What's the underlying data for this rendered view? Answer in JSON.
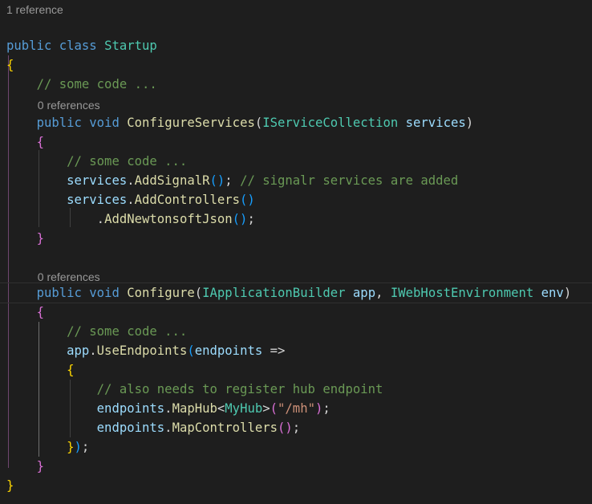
{
  "code": {
    "lines": [
      {
        "lens": "1 reference"
      },
      {
        "tokens": [
          [
            "kw",
            "public"
          ],
          [
            "p",
            " "
          ],
          [
            "kw",
            "class"
          ],
          [
            "p",
            " "
          ],
          [
            "ty",
            "Startup"
          ]
        ]
      },
      {
        "tokens": [
          [
            "br1",
            "{"
          ]
        ]
      },
      {
        "tokens": [
          [
            "p",
            "    "
          ],
          [
            "cm",
            "// some code ..."
          ]
        ]
      },
      {
        "tokens": []
      },
      {
        "lens": "0 references",
        "indent": "    "
      },
      {
        "tokens": [
          [
            "p",
            "    "
          ],
          [
            "kw",
            "public"
          ],
          [
            "p",
            " "
          ],
          [
            "kw",
            "void"
          ],
          [
            "p",
            " "
          ],
          [
            "fn",
            "ConfigureServices"
          ],
          [
            "p",
            "("
          ],
          [
            "ty",
            "IServiceCollection"
          ],
          [
            "p",
            " "
          ],
          [
            "var",
            "services"
          ],
          [
            "p",
            ")"
          ]
        ]
      },
      {
        "tokens": [
          [
            "p",
            "    "
          ],
          [
            "br2",
            "{"
          ]
        ]
      },
      {
        "tokens": [
          [
            "p",
            "        "
          ],
          [
            "cm",
            "// some code ..."
          ]
        ]
      },
      {
        "tokens": [
          [
            "p",
            "        "
          ],
          [
            "var",
            "services"
          ],
          [
            "p",
            "."
          ],
          [
            "fn",
            "AddSignalR"
          ],
          [
            "br3",
            "()"
          ],
          [
            "p",
            "; "
          ],
          [
            "cm",
            "// signalr services are added"
          ]
        ]
      },
      {
        "tokens": [
          [
            "p",
            "        "
          ],
          [
            "var",
            "services"
          ],
          [
            "p",
            "."
          ],
          [
            "fn",
            "AddControllers"
          ],
          [
            "br3",
            "()"
          ]
        ]
      },
      {
        "tokens": [
          [
            "p",
            "            ."
          ],
          [
            "fn",
            "AddNewtonsoftJson"
          ],
          [
            "br3",
            "()"
          ],
          [
            "p",
            ";"
          ]
        ]
      },
      {
        "tokens": [
          [
            "p",
            "    "
          ],
          [
            "br2",
            "}"
          ]
        ]
      },
      {
        "tokens": []
      },
      {
        "lens": "0 references",
        "indent": "    "
      },
      {
        "tokens": [
          [
            "p",
            "    "
          ],
          [
            "kw",
            "public"
          ],
          [
            "p",
            " "
          ],
          [
            "kw",
            "void"
          ],
          [
            "p",
            " "
          ],
          [
            "fn",
            "Configure"
          ],
          [
            "p",
            "("
          ],
          [
            "ty",
            "IApplicationBuilder"
          ],
          [
            "p",
            " "
          ],
          [
            "var",
            "app"
          ],
          [
            "p",
            ", "
          ],
          [
            "ty",
            "IWebHostEnvironment"
          ],
          [
            "p",
            " "
          ],
          [
            "var",
            "env"
          ],
          [
            "p",
            ")"
          ]
        ],
        "current": true
      },
      {
        "tokens": [
          [
            "p",
            "    "
          ],
          [
            "br2",
            "{"
          ]
        ]
      },
      {
        "tokens": [
          [
            "p",
            "        "
          ],
          [
            "cm",
            "// some code ..."
          ]
        ]
      },
      {
        "tokens": [
          [
            "p",
            "        "
          ],
          [
            "var",
            "app"
          ],
          [
            "p",
            "."
          ],
          [
            "fn",
            "UseEndpoints"
          ],
          [
            "br3",
            "("
          ],
          [
            "var",
            "endpoints"
          ],
          [
            "p",
            " =>"
          ]
        ]
      },
      {
        "tokens": [
          [
            "p",
            "        "
          ],
          [
            "br1",
            "{"
          ]
        ]
      },
      {
        "tokens": [
          [
            "p",
            "            "
          ],
          [
            "cm",
            "// also needs to register hub endpoint"
          ]
        ]
      },
      {
        "tokens": [
          [
            "p",
            "            "
          ],
          [
            "var",
            "endpoints"
          ],
          [
            "p",
            "."
          ],
          [
            "fn",
            "MapHub"
          ],
          [
            "p",
            "<"
          ],
          [
            "ty",
            "MyHub"
          ],
          [
            "p",
            ">"
          ],
          [
            "br2",
            "("
          ],
          [
            "str",
            "\"/mh\""
          ],
          [
            "br2",
            ")"
          ],
          [
            "p",
            ";"
          ]
        ]
      },
      {
        "tokens": [
          [
            "p",
            "            "
          ],
          [
            "var",
            "endpoints"
          ],
          [
            "p",
            "."
          ],
          [
            "fn",
            "MapControllers"
          ],
          [
            "br2",
            "()"
          ],
          [
            "p",
            ";"
          ]
        ]
      },
      {
        "tokens": [
          [
            "p",
            "        "
          ],
          [
            "br1",
            "}"
          ],
          [
            "br3",
            ")"
          ],
          [
            "p",
            ";"
          ]
        ]
      },
      {
        "tokens": [
          [
            "p",
            "    "
          ],
          [
            "br2",
            "}"
          ]
        ]
      },
      {
        "tokens": [
          [
            "br1",
            "}"
          ]
        ]
      }
    ]
  }
}
